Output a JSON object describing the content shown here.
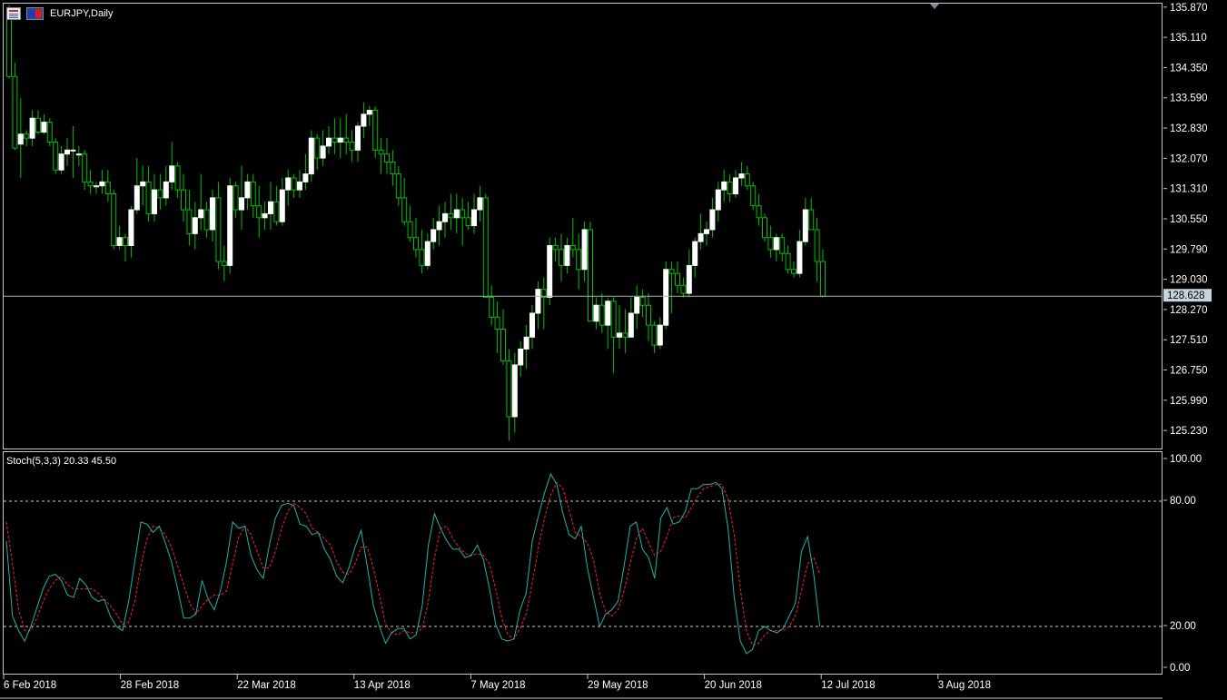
{
  "window": {
    "symbol_title": "EURJPY,Daily",
    "icons": [
      "chart-window-icon",
      "flag-icon"
    ]
  },
  "colors": {
    "background": "#000000",
    "candle_bull": "#ffffff",
    "candle_bear_fill": "#000000",
    "wick": "#00c000",
    "bid_line": "#a8b4bc",
    "stoch_main": "#20b2aa",
    "stoch_signal": "#ff2020",
    "level_line": "#c8c8c8",
    "axis_text": "#ffffff"
  },
  "price_axis": {
    "labels": [
      "135.870",
      "135.110",
      "134.350",
      "133.590",
      "132.830",
      "132.070",
      "131.310",
      "130.550",
      "129.790",
      "129.030",
      "128.270",
      "127.510",
      "126.750",
      "125.990",
      "125.230"
    ],
    "current_price": "128.628"
  },
  "stoch": {
    "title": "Stoch(5,3,3) 20.33 45.50",
    "axis_labels": [
      "100.00",
      "80.00",
      "20.00",
      "0.00"
    ],
    "levels": [
      80,
      20
    ],
    "main": [
      61,
      25,
      18,
      13,
      20,
      29,
      38,
      44,
      45,
      42,
      35,
      34,
      43,
      40,
      34,
      32,
      33,
      25,
      20,
      18,
      32,
      51,
      70,
      69,
      65,
      68,
      60,
      51,
      38,
      24,
      24,
      26,
      42,
      33,
      28,
      37,
      51,
      70,
      67,
      68,
      54,
      47,
      43,
      59,
      72,
      78,
      79,
      78,
      69,
      68,
      64,
      65,
      57,
      52,
      44,
      41,
      48,
      58,
      66,
      49,
      30,
      20,
      12,
      17,
      19,
      19,
      14,
      16,
      30,
      59,
      74,
      67,
      61,
      57,
      57,
      53,
      54,
      59,
      52,
      38,
      21,
      14,
      13,
      14,
      28,
      36,
      61,
      73,
      84,
      93,
      88,
      74,
      64,
      62,
      68,
      48,
      34,
      20,
      26,
      28,
      32,
      49,
      68,
      70,
      57,
      53,
      43,
      72,
      77,
      69,
      70,
      75,
      86,
      86,
      88,
      88,
      89,
      86,
      67,
      34,
      13,
      7,
      9,
      18,
      20,
      18,
      17,
      19,
      25,
      31,
      56,
      63,
      45,
      20
    ],
    "signal": [
      70,
      50,
      28,
      18,
      18,
      24,
      32,
      38,
      42,
      44,
      40,
      38,
      38,
      38,
      38,
      36,
      33,
      30,
      26,
      21,
      22,
      32,
      49,
      62,
      68,
      67,
      64,
      58,
      49,
      40,
      31,
      26,
      30,
      33,
      35,
      35,
      37,
      50,
      63,
      68,
      64,
      56,
      48,
      48,
      56,
      67,
      75,
      79,
      77,
      74,
      67,
      65,
      62,
      59,
      51,
      46,
      45,
      50,
      58,
      58,
      48,
      35,
      21,
      17,
      16,
      18,
      17,
      17,
      19,
      32,
      53,
      67,
      68,
      62,
      58,
      55,
      54,
      55,
      54,
      50,
      38,
      24,
      16,
      14,
      19,
      26,
      41,
      58,
      72,
      83,
      89,
      86,
      76,
      65,
      63,
      60,
      52,
      36,
      27,
      25,
      28,
      37,
      50,
      62,
      67,
      60,
      54,
      56,
      63,
      72,
      73,
      72,
      77,
      82,
      86,
      87,
      88,
      88,
      81,
      64,
      38,
      18,
      11,
      12,
      16,
      18,
      18,
      18,
      20,
      25,
      37,
      50,
      53,
      45
    ]
  },
  "time_axis": {
    "labels": [
      "6 Feb 2018",
      "28 Feb 2018",
      "22 Mar 2018",
      "13 Apr 2018",
      "7 May 2018",
      "29 May 2018",
      "20 Jun 2018",
      "12 Jul 2018",
      "3 Aug 2018"
    ]
  },
  "chart_data": [
    {
      "type": "candlestick",
      "title": "EURJPY,Daily",
      "ylim": [
        124.8,
        135.98
      ],
      "x_range": [
        "6 Feb 2018",
        "3 Aug 2018"
      ],
      "ohlc": [
        [
          135.75,
          135.95,
          134.1,
          134.15
        ],
        [
          134.15,
          134.5,
          132.3,
          132.35
        ],
        [
          132.45,
          133.6,
          131.6,
          132.7
        ],
        [
          132.7,
          132.8,
          132.4,
          132.6
        ],
        [
          132.6,
          133.3,
          132.4,
          133.1
        ],
        [
          133.1,
          133.3,
          132.7,
          132.75
        ],
        [
          132.75,
          133.2,
          132.7,
          133.0
        ],
        [
          133.0,
          133.1,
          132.4,
          132.5
        ],
        [
          132.5,
          132.6,
          131.7,
          131.8
        ],
        [
          131.8,
          132.4,
          131.7,
          132.2
        ],
        [
          132.2,
          132.6,
          131.9,
          132.3
        ],
        [
          132.3,
          132.9,
          131.6,
          132.3
        ],
        [
          132.2,
          132.4,
          131.9,
          132.2
        ],
        [
          132.2,
          132.3,
          131.3,
          131.5
        ],
        [
          131.5,
          131.8,
          131.2,
          131.4
        ],
        [
          131.4,
          131.5,
          131.2,
          131.4
        ],
        [
          131.4,
          131.8,
          131.2,
          131.5
        ],
        [
          131.5,
          131.8,
          131.0,
          131.2
        ],
        [
          131.2,
          131.3,
          129.8,
          129.9
        ],
        [
          129.9,
          130.4,
          129.8,
          130.1
        ],
        [
          130.1,
          130.2,
          129.5,
          129.9
        ],
        [
          129.9,
          130.9,
          129.6,
          130.8
        ],
        [
          130.8,
          132.1,
          130.7,
          131.4
        ],
        [
          131.4,
          131.9,
          130.9,
          131.5
        ],
        [
          131.5,
          131.9,
          130.5,
          130.7
        ],
        [
          130.7,
          131.7,
          130.5,
          131.3
        ],
        [
          131.3,
          131.7,
          130.8,
          131.1
        ],
        [
          131.1,
          131.9,
          130.9,
          131.5
        ],
        [
          131.5,
          132.5,
          131.3,
          131.9
        ],
        [
          131.9,
          132.0,
          131.1,
          131.3
        ],
        [
          131.3,
          131.7,
          130.5,
          130.8
        ],
        [
          130.8,
          131.3,
          129.9,
          130.2
        ],
        [
          130.2,
          131.0,
          129.8,
          130.6
        ],
        [
          130.6,
          131.7,
          130.3,
          130.8
        ],
        [
          130.8,
          131.0,
          130.1,
          130.3
        ],
        [
          130.3,
          131.3,
          130.0,
          131.1
        ],
        [
          131.1,
          131.5,
          129.3,
          129.5
        ],
        [
          129.5,
          129.9,
          129.0,
          129.4
        ],
        [
          129.4,
          131.6,
          129.2,
          131.4
        ],
        [
          131.4,
          131.5,
          130.6,
          130.8
        ],
        [
          130.8,
          131.9,
          130.3,
          131.1
        ],
        [
          131.1,
          131.7,
          130.8,
          131.5
        ],
        [
          131.5,
          131.7,
          130.6,
          130.9
        ],
        [
          130.9,
          131.4,
          130.1,
          130.6
        ],
        [
          130.6,
          131.0,
          130.3,
          130.7
        ],
        [
          130.7,
          131.5,
          130.3,
          131.0
        ],
        [
          131.0,
          131.4,
          130.4,
          130.5
        ],
        [
          130.5,
          131.6,
          130.4,
          131.3
        ],
        [
          131.3,
          131.8,
          130.9,
          131.6
        ],
        [
          131.6,
          131.7,
          131.1,
          131.3
        ],
        [
          131.3,
          131.8,
          131.1,
          131.5
        ],
        [
          131.5,
          132.2,
          131.3,
          131.7
        ],
        [
          131.7,
          132.8,
          131.5,
          132.6
        ],
        [
          132.6,
          132.7,
          131.8,
          132.1
        ],
        [
          132.1,
          132.8,
          131.9,
          132.4
        ],
        [
          132.4,
          132.9,
          132.2,
          132.6
        ],
        [
          132.6,
          133.1,
          132.2,
          132.5
        ],
        [
          132.5,
          133.1,
          132.1,
          132.6
        ],
        [
          132.6,
          133.2,
          132.2,
          132.5
        ],
        [
          132.5,
          132.8,
          132.0,
          132.3
        ],
        [
          132.3,
          133.0,
          132.0,
          132.9
        ],
        [
          132.9,
          133.5,
          132.6,
          133.2
        ],
        [
          133.2,
          133.4,
          132.9,
          133.3
        ],
        [
          133.3,
          133.4,
          132.1,
          132.3
        ],
        [
          132.3,
          132.6,
          131.7,
          132.2
        ],
        [
          132.2,
          132.6,
          131.7,
          132.0
        ],
        [
          132.0,
          132.3,
          131.4,
          131.7
        ],
        [
          131.7,
          131.9,
          130.9,
          131.1
        ],
        [
          131.1,
          131.6,
          130.4,
          130.5
        ],
        [
          130.5,
          130.9,
          130.0,
          130.1
        ],
        [
          130.1,
          130.6,
          129.6,
          129.8
        ],
        [
          129.8,
          130.3,
          129.2,
          129.4
        ],
        [
          129.4,
          130.2,
          129.3,
          130.0
        ],
        [
          130.0,
          130.6,
          129.8,
          130.3
        ],
        [
          130.3,
          130.9,
          129.9,
          130.5
        ],
        [
          130.5,
          131.0,
          130.1,
          130.7
        ],
        [
          130.7,
          131.2,
          130.3,
          130.6
        ],
        [
          130.6,
          131.2,
          130.2,
          130.8
        ],
        [
          130.8,
          131.1,
          129.9,
          130.6
        ],
        [
          130.6,
          131.0,
          130.3,
          130.4
        ],
        [
          130.4,
          131.2,
          130.2,
          130.8
        ],
        [
          130.8,
          131.4,
          130.5,
          131.1
        ],
        [
          131.1,
          131.2,
          128.9,
          128.6
        ],
        [
          128.6,
          128.9,
          127.9,
          128.1
        ],
        [
          128.1,
          128.5,
          127.2,
          127.8
        ],
        [
          127.8,
          128.3,
          126.9,
          127.0
        ],
        [
          127.0,
          127.3,
          125.0,
          125.6
        ],
        [
          125.6,
          127.2,
          125.2,
          126.9
        ],
        [
          126.9,
          127.5,
          126.6,
          127.3
        ],
        [
          127.3,
          127.9,
          126.8,
          127.6
        ],
        [
          127.6,
          128.4,
          127.3,
          128.2
        ],
        [
          128.2,
          129.0,
          127.8,
          128.8
        ],
        [
          128.8,
          129.1,
          127.8,
          128.6
        ],
        [
          128.6,
          130.1,
          128.4,
          129.9
        ],
        [
          129.9,
          130.1,
          129.5,
          129.8
        ],
        [
          129.8,
          130.2,
          129.0,
          129.4
        ],
        [
          129.4,
          130.1,
          129.2,
          129.9
        ],
        [
          129.9,
          130.6,
          129.6,
          129.8
        ],
        [
          129.8,
          130.2,
          128.8,
          129.3
        ],
        [
          129.3,
          130.5,
          129.0,
          130.3
        ],
        [
          130.3,
          130.5,
          128.0,
          128.0
        ],
        [
          128.0,
          128.6,
          127.8,
          128.4
        ],
        [
          128.4,
          128.7,
          127.7,
          127.9
        ],
        [
          127.9,
          128.6,
          127.3,
          128.5
        ],
        [
          128.5,
          128.6,
          126.7,
          127.6
        ],
        [
          127.6,
          128.4,
          127.3,
          127.7
        ],
        [
          127.7,
          128.3,
          127.2,
          127.6
        ],
        [
          127.6,
          128.6,
          127.6,
          128.2
        ],
        [
          128.2,
          128.9,
          127.8,
          128.6
        ],
        [
          128.6,
          128.8,
          128.1,
          128.4
        ],
        [
          128.4,
          128.7,
          127.5,
          127.9
        ],
        [
          127.9,
          128.0,
          127.2,
          127.4
        ],
        [
          127.4,
          128.1,
          127.3,
          127.9
        ],
        [
          127.9,
          129.5,
          127.8,
          129.3
        ],
        [
          129.3,
          129.5,
          128.2,
          129.2
        ],
        [
          129.2,
          129.5,
          128.7,
          128.9
        ],
        [
          128.9,
          129.1,
          128.6,
          128.7
        ],
        [
          128.7,
          129.8,
          128.6,
          129.4
        ],
        [
          129.4,
          130.1,
          129.1,
          130.0
        ],
        [
          130.0,
          130.7,
          129.8,
          130.2
        ],
        [
          130.2,
          130.5,
          129.9,
          130.3
        ],
        [
          130.3,
          131.1,
          130.1,
          130.8
        ],
        [
          130.8,
          131.5,
          130.5,
          131.3
        ],
        [
          131.3,
          131.8,
          131.0,
          131.5
        ],
        [
          131.5,
          131.7,
          131.0,
          131.2
        ],
        [
          131.2,
          131.8,
          131.1,
          131.6
        ],
        [
          131.6,
          132.0,
          131.4,
          131.7
        ],
        [
          131.7,
          131.9,
          131.3,
          131.4
        ],
        [
          131.4,
          131.5,
          130.8,
          130.9
        ],
        [
          130.9,
          131.2,
          130.4,
          130.6
        ],
        [
          130.6,
          130.7,
          130.0,
          130.1
        ],
        [
          130.1,
          130.4,
          129.6,
          129.8
        ],
        [
          129.8,
          130.2,
          129.5,
          130.1
        ],
        [
          130.1,
          130.2,
          129.5,
          129.7
        ],
        [
          129.7,
          129.9,
          129.2,
          129.3
        ],
        [
          129.3,
          129.5,
          129.1,
          129.2
        ],
        [
          129.2,
          130.3,
          129.1,
          130.0
        ],
        [
          130.0,
          131.1,
          129.9,
          130.8
        ],
        [
          130.8,
          131.1,
          130.3,
          130.3
        ],
        [
          130.3,
          130.6,
          129.0,
          129.5
        ],
        [
          129.5,
          129.8,
          128.6,
          128.63
        ]
      ]
    },
    {
      "type": "line",
      "title": "Stoch(5,3,3) 20.33 45.50",
      "ylim": [
        0,
        100
      ]
    }
  ]
}
